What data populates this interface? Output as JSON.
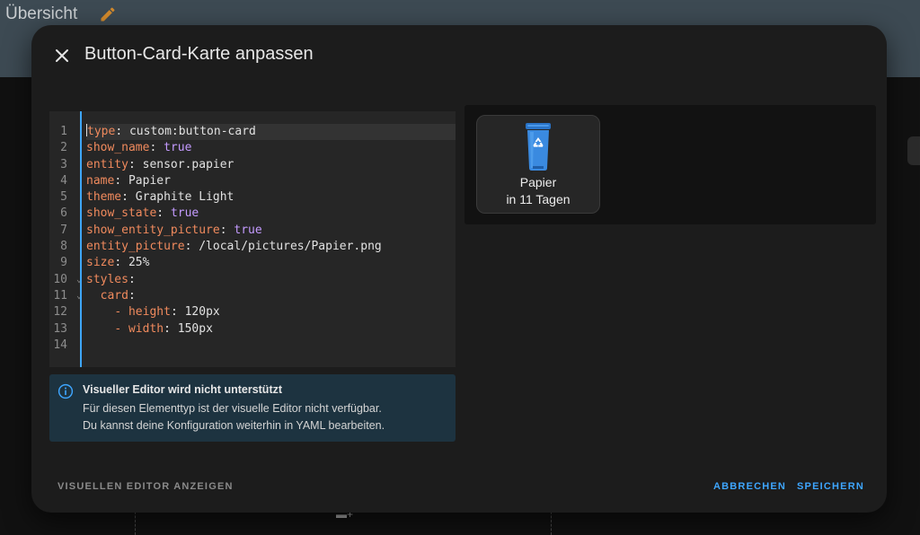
{
  "topbar": {
    "title": "Übersicht"
  },
  "dialog": {
    "title": "Button-Card-Karte anpassen",
    "editor": {
      "line_numbers": [
        "1",
        "2",
        "3",
        "4",
        "5",
        "6",
        "7",
        "8",
        "9",
        "10",
        "11",
        "12",
        "13",
        "14"
      ],
      "lines": [
        {
          "key": "type",
          "value": "custom:button-card"
        },
        {
          "key": "show_name",
          "value": "true"
        },
        {
          "key": "entity",
          "value": "sensor.papier"
        },
        {
          "key": "name",
          "value": "Papier"
        },
        {
          "key": "theme",
          "value": "Graphite Light"
        },
        {
          "key": "show_state",
          "value": "true"
        },
        {
          "key": "show_entity_picture",
          "value": "true"
        },
        {
          "key": "entity_picture",
          "value": "/local/pictures/Papier.png"
        },
        {
          "key": "size",
          "value": "25%"
        },
        {
          "key": "styles",
          "value": ""
        },
        {
          "key": "card",
          "value": ""
        },
        {
          "key": "height",
          "value": "120px"
        },
        {
          "key": "width",
          "value": "150px"
        },
        {
          "key": "",
          "value": ""
        }
      ]
    },
    "info": {
      "title": "Visueller Editor wird nicht unterstützt",
      "line1": "Für diesen Elementtyp ist der visuelle Editor nicht verfügbar.",
      "line2": "Du kannst deine Konfiguration weiterhin in YAML bearbeiten."
    },
    "preview": {
      "card_name": "Papier",
      "card_state": "in 11 Tagen"
    },
    "footer": {
      "show_visual_editor": "VISUELLEN EDITOR ANZEIGEN",
      "cancel": "ABBRECHEN",
      "save": "SPEICHERN"
    }
  },
  "colors": {
    "accent": "#3ea6ff",
    "yaml_key": "#f08a5d",
    "yaml_bool": "#c49bff",
    "info_bg": "#1d3340"
  }
}
